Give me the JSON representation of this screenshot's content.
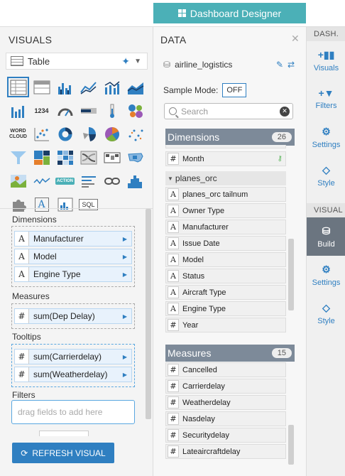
{
  "banner": {
    "label": "Dashboard Designer"
  },
  "visuals": {
    "title": "VISUALS",
    "type_selected": "Table",
    "icon_text_1234": "1234",
    "icon_text_action": "ACTION",
    "icon_text_sql": "SQL",
    "icon_text_wordcloud": "WORD CLOUD",
    "shelves": {
      "dimensions_label": "Dimensions",
      "dimensions": [
        "Manufacturer",
        "Model",
        "Engine Type"
      ],
      "measures_label": "Measures",
      "measures": [
        "sum(Dep Delay)"
      ],
      "tooltips_label": "Tooltips",
      "tooltips": [
        "sum(Carrierdelay)",
        "sum(Weatherdelay)"
      ],
      "filters_label": "Filters",
      "filters_placeholder": "drag fields to add here"
    },
    "refresh_label": "REFRESH VISUAL"
  },
  "data": {
    "title": "DATA",
    "dataset": "airline_logistics",
    "sample_mode_label": "Sample Mode:",
    "sample_mode_value": "OFF",
    "search_placeholder": "Search",
    "dimensions_header": "Dimensions",
    "dimensions_count": "26",
    "month_field": "Month",
    "group_name": "planes_orc",
    "planes_fields": [
      {
        "type": "A",
        "name": "planes_orc tailnum"
      },
      {
        "type": "A",
        "name": "Owner Type"
      },
      {
        "type": "A",
        "name": "Manufacturer"
      },
      {
        "type": "A",
        "name": "Issue Date"
      },
      {
        "type": "A",
        "name": "Model"
      },
      {
        "type": "A",
        "name": "Status"
      },
      {
        "type": "A",
        "name": "Aircraft Type"
      },
      {
        "type": "A",
        "name": "Engine Type"
      },
      {
        "type": "#",
        "name": "Year"
      }
    ],
    "measures_header": "Measures",
    "measures_count": "15",
    "measure_fields": [
      "Cancelled",
      "Carrierdelay",
      "Weatherdelay",
      "Nasdelay",
      "Securitydelay",
      "Lateaircraftdelay"
    ]
  },
  "rail": {
    "dash_head": "DASH.",
    "visual_head": "VISUAL",
    "dash_items": [
      "Visuals",
      "Filters",
      "Settings",
      "Style"
    ],
    "visual_items": [
      "Build",
      "Settings",
      "Style"
    ]
  },
  "colors": {
    "accent": "#2f7fc1",
    "banner": "#4bb0b7",
    "section_header": "#7d8a99",
    "rail_active": "#6b7580"
  }
}
